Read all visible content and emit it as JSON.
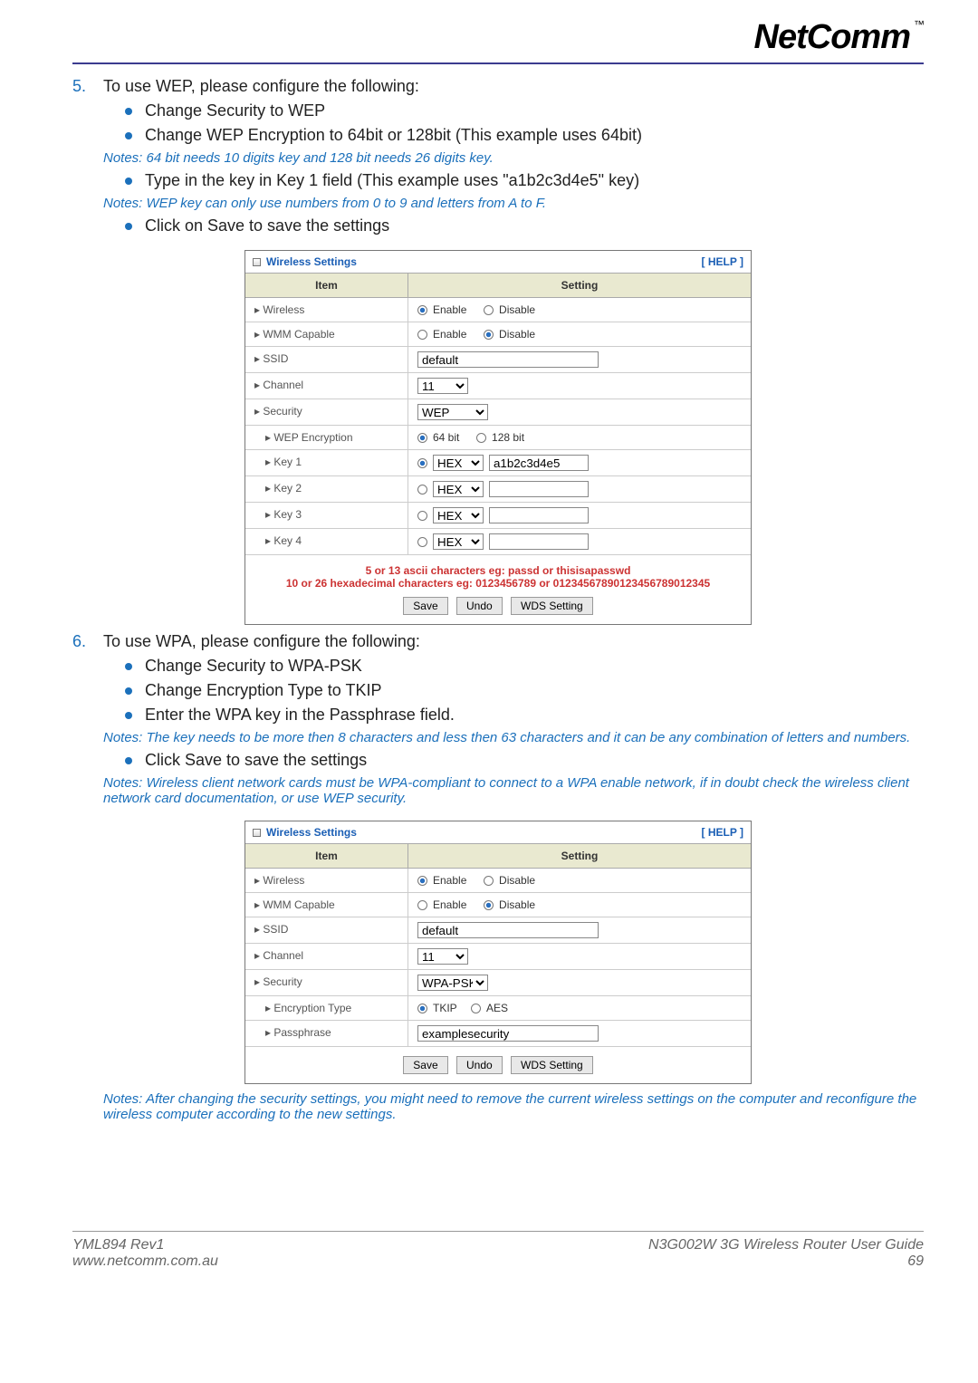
{
  "logo": {
    "text": "NetComm",
    "tm": "™"
  },
  "step5": {
    "num": "5.",
    "text": "To use WEP, please configure the following:",
    "bullets": [
      "Change Security to WEP",
      "Change WEP Encryption to 64bit or 128bit (This example uses 64bit)"
    ],
    "note1": "Notes: 64 bit needs 10 digits key and 128 bit needs 26 digits key.",
    "bullet3": "Type in the key in Key 1 field (This example uses \"a1b2c3d4e5\" key)",
    "note2": "Notes: WEP key can only use numbers from 0 to 9 and letters from A to F.",
    "bullet4": "Click on Save to save the settings"
  },
  "step6": {
    "num": "6.",
    "text": "To use WPA, please configure the following:",
    "bullets": [
      "Change Security to WPA-PSK",
      "Change Encryption Type to TKIP",
      "Enter the WPA key in the Passphrase field."
    ],
    "note1": "Notes: The key needs to be more then 8 characters and less then 63 characters and it can be any combination of letters and numbers.",
    "bullet4": "Click Save to save the settings",
    "note2": "Notes: Wireless client network cards must be WPA-compliant to connect to a WPA enable network, if in doubt check the wireless client network card documentation, or use WEP security.",
    "note3": "Notes: After changing the security settings, you might need to remove the current wireless settings on the computer and reconfigure the wireless computer according to the new settings."
  },
  "table1": {
    "title": "Wireless Settings",
    "help": "[ HELP ]",
    "col1": "Item",
    "col2": "Setting",
    "rows": {
      "wireless": "▸ Wireless",
      "wmm": "▸ WMM Capable",
      "ssid": "▸ SSID",
      "channel": "▸ Channel",
      "security": "▸ Security",
      "wepenc": "▸ WEP Encryption",
      "key1": "▸ Key 1",
      "key2": "▸ Key 2",
      "key3": "▸ Key 3",
      "key4": "▸ Key 4"
    },
    "vals": {
      "enable": "Enable",
      "disable": "Disable",
      "ssid": "default",
      "channel": "11",
      "security": "WEP",
      "b64": "64 bit",
      "b128": "128 bit",
      "hex": "HEX",
      "key1": "a1b2c3d4e5"
    },
    "footer1": "5 or 13 ascii characters eg: passd or thisisapasswd",
    "footer2": "10 or 26 hexadecimal characters eg: 0123456789 or 01234567890123456789012345",
    "btn": {
      "save": "Save",
      "undo": "Undo",
      "wds": "WDS Setting"
    }
  },
  "table2": {
    "title": "Wireless Settings",
    "help": "[ HELP ]",
    "col1": "Item",
    "col2": "Setting",
    "rows": {
      "wireless": "▸ Wireless",
      "wmm": "▸ WMM Capable",
      "ssid": "▸ SSID",
      "channel": "▸ Channel",
      "security": "▸ Security",
      "enctype": "▸ Encryption Type",
      "pass": "▸ Passphrase"
    },
    "vals": {
      "enable": "Enable",
      "disable": "Disable",
      "ssid": "default",
      "channel": "11",
      "security": "WPA-PSK",
      "tkip": "TKIP",
      "aes": "AES",
      "pass": "examplesecurity"
    },
    "btn": {
      "save": "Save",
      "undo": "Undo",
      "wds": "WDS Setting"
    }
  },
  "footer": {
    "left1": "YML894 Rev1",
    "left2": "www.netcomm.com.au",
    "right1": "N3G002W 3G Wireless Router User Guide",
    "right2": "69"
  }
}
